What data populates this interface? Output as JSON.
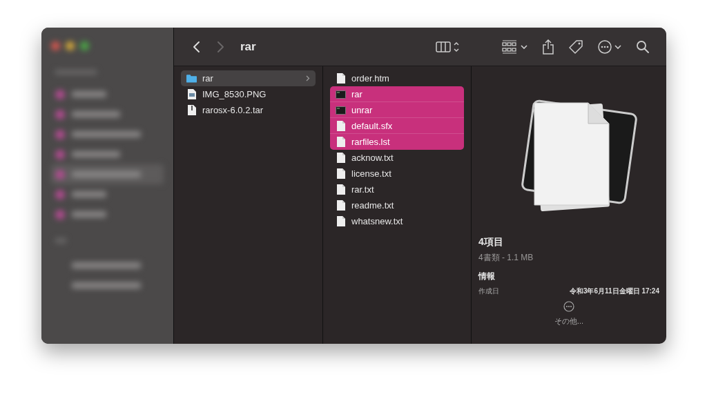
{
  "toolbar": {
    "title": "rar"
  },
  "columns": [
    {
      "items": [
        {
          "name": "rar",
          "kind": "folder",
          "selected": true,
          "expandable": true
        },
        {
          "name": "IMG_8530.PNG",
          "kind": "image",
          "selected": false,
          "expandable": false
        },
        {
          "name": "rarosx-6.0.2.tar",
          "kind": "archive",
          "selected": false,
          "expandable": false
        }
      ]
    },
    {
      "items": [
        {
          "name": "order.htm",
          "kind": "document",
          "selected": false,
          "expandable": false
        },
        {
          "name": "rar",
          "kind": "executable",
          "selected": true,
          "expandable": false
        },
        {
          "name": "unrar",
          "kind": "executable",
          "selected": true,
          "expandable": false
        },
        {
          "name": "default.sfx",
          "kind": "document",
          "selected": true,
          "expandable": false
        },
        {
          "name": "rarfiles.lst",
          "kind": "document",
          "selected": true,
          "expandable": false
        },
        {
          "name": "acknow.txt",
          "kind": "document",
          "selected": false,
          "expandable": false
        },
        {
          "name": "license.txt",
          "kind": "document",
          "selected": false,
          "expandable": false
        },
        {
          "name": "rar.txt",
          "kind": "document",
          "selected": false,
          "expandable": false
        },
        {
          "name": "readme.txt",
          "kind": "document",
          "selected": false,
          "expandable": false
        },
        {
          "name": "whatsnew.txt",
          "kind": "document",
          "selected": false,
          "expandable": false
        }
      ]
    }
  ],
  "preview": {
    "title": "4項目",
    "subtitle": "4書類 - 1.1 MB",
    "section": "情報",
    "info_rows": [
      {
        "label": "作成日",
        "value": "令和3年6月11日金曜日 17:24"
      }
    ],
    "more": "その他..."
  }
}
